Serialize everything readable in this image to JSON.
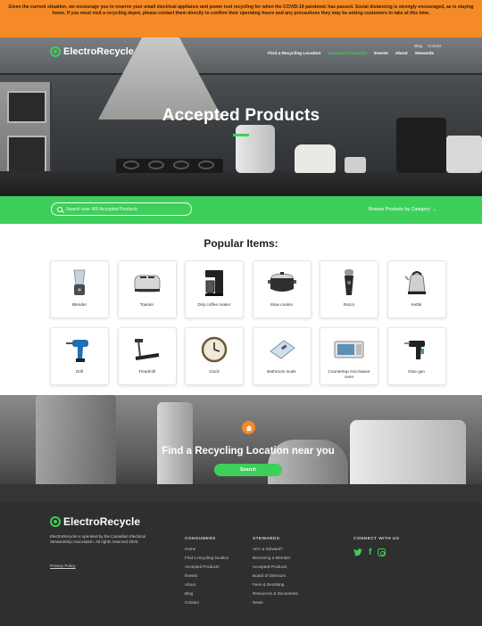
{
  "banner": {
    "text": "Given the current situation, we encourage you to reserve your small electrical appliance and power tool recycling for when the COVID-19 pandemic has passed. Social distancing is strongly encouraged, as is staying home. If you must visit a recycling depot, please contact them directly to confirm their operating hours and any precautions they may be asking customers to take at this time."
  },
  "brand": {
    "name_part1": "Electro",
    "name_part2": "Recycle",
    "accent": "#3ecf5a",
    "banner_color": "#f58a26"
  },
  "utility_nav": {
    "blog": "Blog",
    "contact": "Contact"
  },
  "main_nav": {
    "find": "Find a Recycling Location",
    "accepted": "Accepted Products",
    "events": "Events",
    "about": "About",
    "stewards": "Stewards"
  },
  "hero": {
    "title": "Accepted Products"
  },
  "search": {
    "placeholder": "Search over 400 Accepted Products",
    "browse_label": "Browse Products by Category",
    "browse_icon": "chevron-down-icon"
  },
  "popular": {
    "title": "Popular Items:",
    "items": [
      {
        "label": "Blender",
        "icon": "blender-icon"
      },
      {
        "label": "Toaster",
        "icon": "toaster-icon"
      },
      {
        "label": "Drip coffee maker",
        "icon": "coffee-maker-icon"
      },
      {
        "label": "Slow cooker",
        "icon": "slow-cooker-icon"
      },
      {
        "label": "Razor",
        "icon": "razor-icon"
      },
      {
        "label": "Kettle",
        "icon": "kettle-icon"
      },
      {
        "label": "Drill",
        "icon": "drill-icon"
      },
      {
        "label": "Treadmill",
        "icon": "treadmill-icon"
      },
      {
        "label": "Clock",
        "icon": "clock-icon"
      },
      {
        "label": "Bathroom scale",
        "icon": "scale-icon"
      },
      {
        "label": "Countertop microwave oven",
        "icon": "microwave-icon"
      },
      {
        "label": "Glue gun",
        "icon": "glue-gun-icon"
      }
    ]
  },
  "cta": {
    "title": "Find a Recycling Location near you",
    "button": "Search",
    "icon": "home-pin-icon"
  },
  "footer": {
    "about": "ElectroRecycle is operated by the Canadian Electrical Stewardship Association. All rights reserved 2020.",
    "privacy": "Privacy Policy",
    "consumers": {
      "heading": "CONSUMERS",
      "links": [
        "Home",
        "Find a recycling location",
        "Accepted Products",
        "Events",
        "About",
        "Blog",
        "Contact"
      ]
    },
    "stewards": {
      "heading": "STEWARDS",
      "links": [
        "Am I a Steward?",
        "Becoming a Member",
        "Accepted Products",
        "Board of Directors",
        "Fees & Remitting",
        "Resources & Documents",
        "News"
      ]
    },
    "connect": {
      "heading": "CONNECT WITH US",
      "icons": [
        "twitter-icon",
        "facebook-icon",
        "instagram-icon"
      ]
    }
  }
}
